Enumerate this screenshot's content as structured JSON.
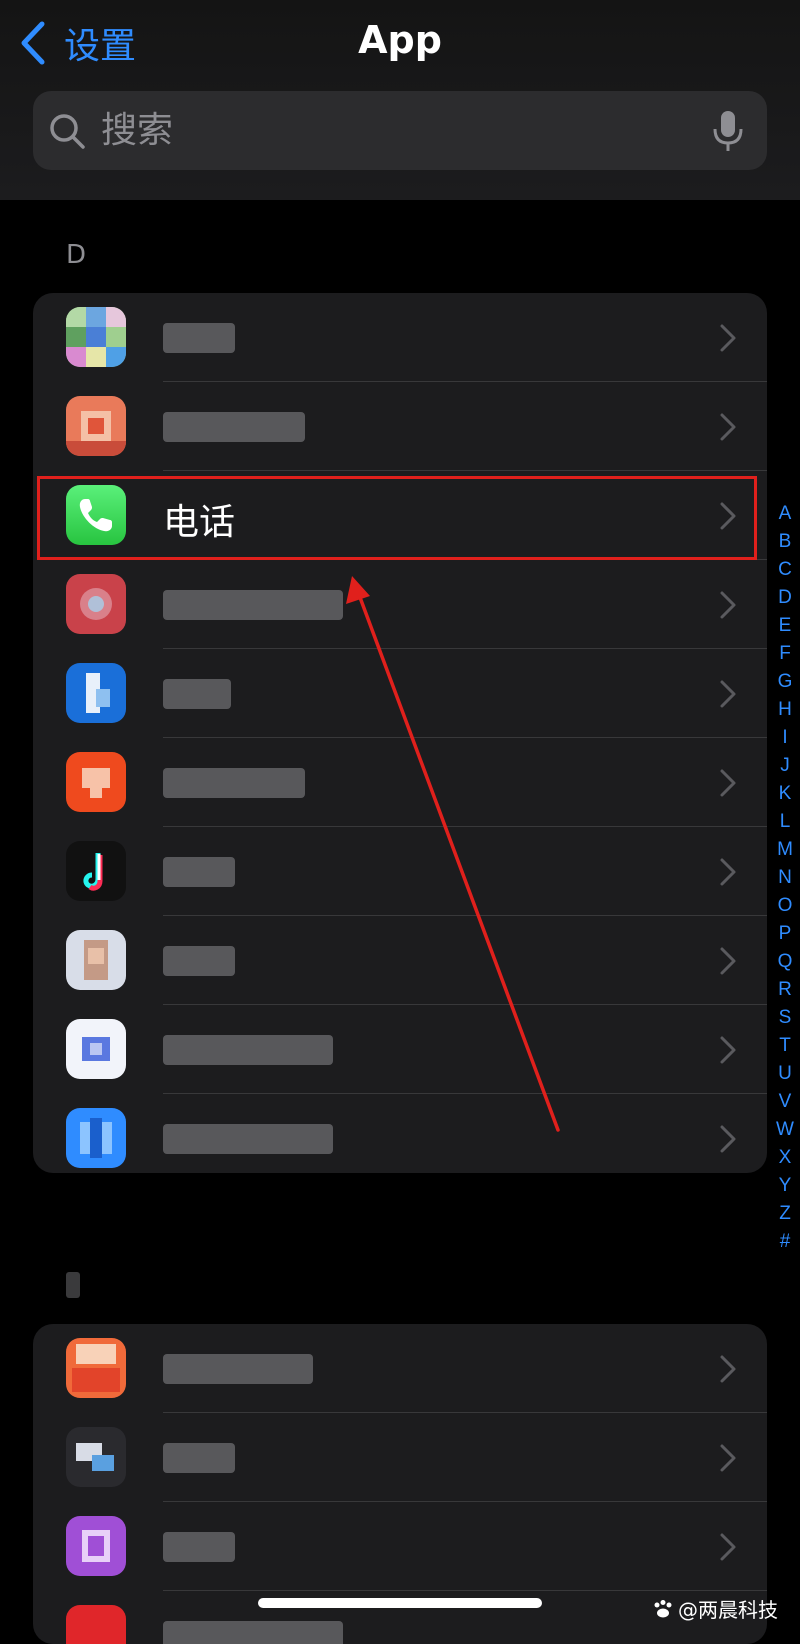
{
  "nav": {
    "back_label": "设置",
    "title": "App"
  },
  "search": {
    "placeholder": "搜索"
  },
  "sections": {
    "d_header": "D"
  },
  "phone_row": {
    "label": "电话"
  },
  "index_letters": [
    "A",
    "B",
    "C",
    "D",
    "E",
    "F",
    "G",
    "H",
    "I",
    "J",
    "K",
    "L",
    "M",
    "N",
    "O",
    "P",
    "Q",
    "R",
    "S",
    "T",
    "U",
    "V",
    "W",
    "X",
    "Y",
    "Z",
    "#"
  ],
  "watermark": "@两晨科技",
  "colors": {
    "accent": "#2f8cff",
    "highlight": "#e0201c",
    "phone_green": "#34c759"
  }
}
